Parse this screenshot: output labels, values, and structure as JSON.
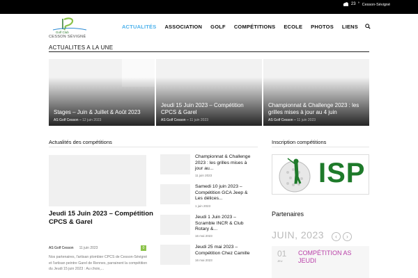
{
  "topbar": {
    "temperature": "23",
    "temperature_unit": "°",
    "city": "Cesson-Sévigné"
  },
  "logo": {
    "line1": "Golf Club",
    "line2": "CESSON SÉVIGNÉ"
  },
  "nav": {
    "items": [
      "ACTUALITÉS",
      "ASSOCIATION",
      "GOLF",
      "COMPÉTITIONS",
      "ECOLE",
      "PHOTOS",
      "LIENS"
    ],
    "active_index": 0
  },
  "une": {
    "title": "ACTUALITES A LA UNE",
    "tiles": [
      {
        "title": "Stages – Juin & Juillet & Août 2023",
        "author": "AS Golf Cesson",
        "date": "12 juin 2023"
      },
      {
        "title": "Jeudi 15 Juin 2023 – Compétition CPCS & Garel",
        "author": "AS Golf Cesson",
        "date": "11 juin 2023"
      },
      {
        "title": "Championnat & Challenge 2023 : les grilles mises à jour au 4 juin",
        "author": "AS Golf Cesson",
        "date": "11 juin 2023"
      }
    ]
  },
  "competitions": {
    "title": "Actualités des compétitions",
    "featured": {
      "title": "Jeudi 15 Juin 2023 – Compétition CPCS & Garel",
      "author": "AS Golf Cesson",
      "date": "11 juin 2023",
      "comments": "0",
      "excerpt": "Nos partenaires, l'artisan plombier CPCS de Cesson-Sévigné et l'artisan peintre Garel de Rennes, parrainent la compétition du Jeudi 15 juin 2023 : Au choix,..."
    },
    "list": [
      {
        "title": "Championnat & Challenge 2023 : les grilles mises à jour au...",
        "date": "11 juin 2023"
      },
      {
        "title": "Samedi 10 juin 2023 – Compétition GCA Jeep & Les délices...",
        "date": "1 juin 2023"
      },
      {
        "title": "Jeudi 1 Juin 2023 – Scramble INCR & Club Rotary &...",
        "date": "16 mai 2023"
      },
      {
        "title": "Jeudi 25 mai 2023 – Compétition Chez Camille",
        "date": "16 mai 2023"
      }
    ]
  },
  "inscription": {
    "title": "Inscription compétitions",
    "logo_text": "ISP"
  },
  "partenaires": {
    "title": "Partenaires",
    "calendar_month": "JUIN, 2023",
    "event_day": "01",
    "event_dow": "JEU",
    "event_title": "COMPÉTITION AS JEUDI"
  },
  "colors": {
    "accent": "#4db2ec",
    "badge": "#8bc34a",
    "event": "#b93fa8"
  }
}
